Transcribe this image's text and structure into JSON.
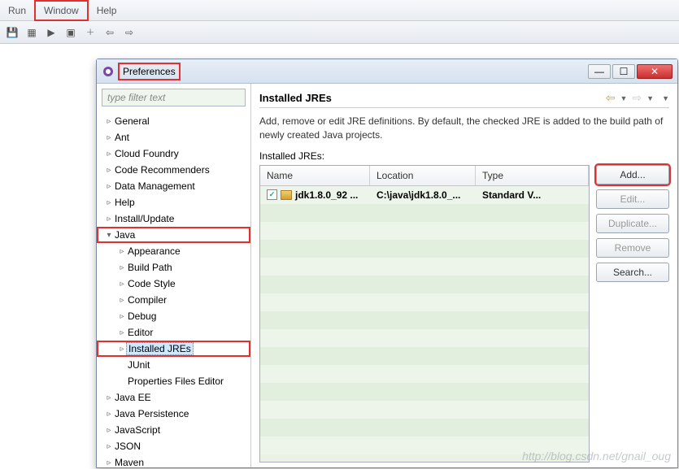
{
  "menubar": {
    "run": "Run",
    "window": "Window",
    "help": "Help"
  },
  "dialog": {
    "title": "Preferences",
    "filter_placeholder": "type filter text",
    "tree": [
      {
        "label": "General",
        "depth": 0,
        "collapsed": true
      },
      {
        "label": "Ant",
        "depth": 0,
        "collapsed": true
      },
      {
        "label": "Cloud Foundry",
        "depth": 0,
        "collapsed": true
      },
      {
        "label": "Code Recommenders",
        "depth": 0,
        "collapsed": true
      },
      {
        "label": "Data Management",
        "depth": 0,
        "collapsed": true
      },
      {
        "label": "Help",
        "depth": 0,
        "collapsed": true
      },
      {
        "label": "Install/Update",
        "depth": 0,
        "collapsed": true
      },
      {
        "label": "Java",
        "depth": 0,
        "collapsed": false,
        "hl": true
      },
      {
        "label": "Appearance",
        "depth": 1,
        "collapsed": true
      },
      {
        "label": "Build Path",
        "depth": 1,
        "collapsed": true
      },
      {
        "label": "Code Style",
        "depth": 1,
        "collapsed": true
      },
      {
        "label": "Compiler",
        "depth": 1,
        "collapsed": true
      },
      {
        "label": "Debug",
        "depth": 1,
        "collapsed": true
      },
      {
        "label": "Editor",
        "depth": 1,
        "collapsed": true
      },
      {
        "label": "Installed JREs",
        "depth": 1,
        "collapsed": true,
        "hl": true,
        "selected": true
      },
      {
        "label": "JUnit",
        "depth": 1
      },
      {
        "label": "Properties Files Editor",
        "depth": 1
      },
      {
        "label": "Java EE",
        "depth": 0,
        "collapsed": true
      },
      {
        "label": "Java Persistence",
        "depth": 0,
        "collapsed": true
      },
      {
        "label": "JavaScript",
        "depth": 0,
        "collapsed": true
      },
      {
        "label": "JSON",
        "depth": 0,
        "collapsed": true
      },
      {
        "label": "Maven",
        "depth": 0,
        "collapsed": true
      }
    ],
    "main": {
      "title": "Installed JREs",
      "description": "Add, remove or edit JRE definitions. By default, the checked JRE is added to the build path of newly created Java projects.",
      "subtitle": "Installed JREs:",
      "columns": {
        "name": "Name",
        "location": "Location",
        "type": "Type"
      },
      "row": {
        "name": "jdk1.8.0_92 ...",
        "location": "C:\\java\\jdk1.8.0_...",
        "type": "Standard V..."
      },
      "buttons": {
        "add": "Add...",
        "edit": "Edit...",
        "duplicate": "Duplicate...",
        "remove": "Remove",
        "search": "Search..."
      }
    }
  },
  "watermark": "http://blog.csdn.net/gnail_oug"
}
